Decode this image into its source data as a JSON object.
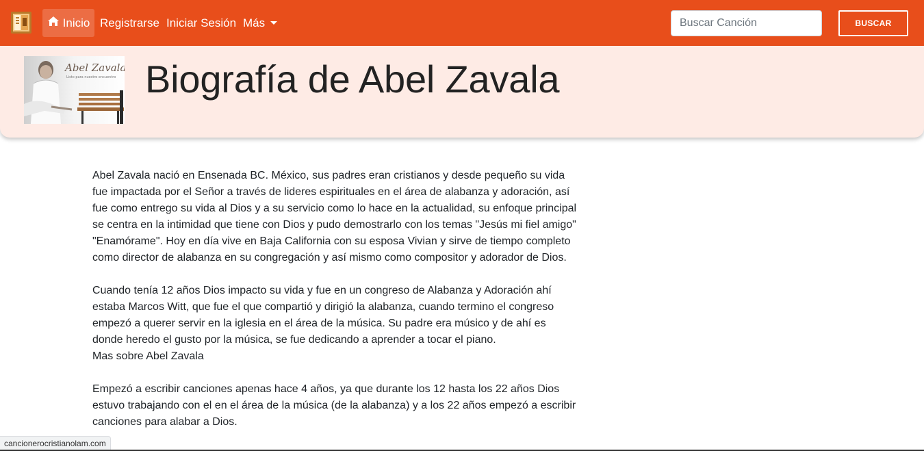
{
  "navbar": {
    "home_label": "Inicio",
    "register_label": "Registrarse",
    "login_label": "Iniciar Sesión",
    "more_label": "Más",
    "search": {
      "placeholder": "Buscar Canción",
      "value": ""
    },
    "search_button_label": "BUSCAR",
    "brand_color": "#e84e1b",
    "icons": [
      "app-logo-icon",
      "home-icon",
      "caret-down-icon"
    ]
  },
  "header": {
    "title": "Biografía de Abel Zavala",
    "band_color": "#feebe5",
    "photo": {
      "signature_text": "Abel Zavala",
      "caption_text": "Listo para nuestro encuentro"
    }
  },
  "bio": {
    "paragraph_1": "Abel Zavala nació en Ensenada BC. México, sus padres eran cristianos y desde pequeño su vida fue impactada por el Señor a través de lideres espirituales en el área de alabanza y adoración, así fue como entrego su vida al Dios y a su servicio como lo hace en la actualidad, su enfoque principal se centra en la intimidad que tiene con Dios y pudo demostrarlo con los temas \"Jesús mi fiel amigo\" \"Enamórame\". Hoy en día vive en Baja California con su esposa Vivian y sirve de tiempo completo como director de alabanza en su congregación y así mismo como compositor y adorador de Dios.",
    "paragraph_2": "Cuando tenía 12 años Dios impacto su vida y fue en un congreso de Alabanza y Adoración ahí estaba Marcos Witt, que fue el que compartió y dirigió la alabanza, cuando termino el congreso empezó a querer servir en la iglesia en el área de la música. Su padre era músico y de ahí es donde heredo el gusto por la música, se fue dedicando a aprender a tocar el piano.",
    "more_link": "Mas sobre Abel Zavala",
    "paragraph_3": "Empezó a escribir canciones apenas hace 4 años, ya que durante los 12 hasta los 22 años Dios estuvo trabajando con el en el área de la música (de la alabanza) y a los 22 años empezó a escribir canciones para alabar a Dios."
  },
  "status_bar": {
    "url": "cancionerocristianolam.com"
  }
}
